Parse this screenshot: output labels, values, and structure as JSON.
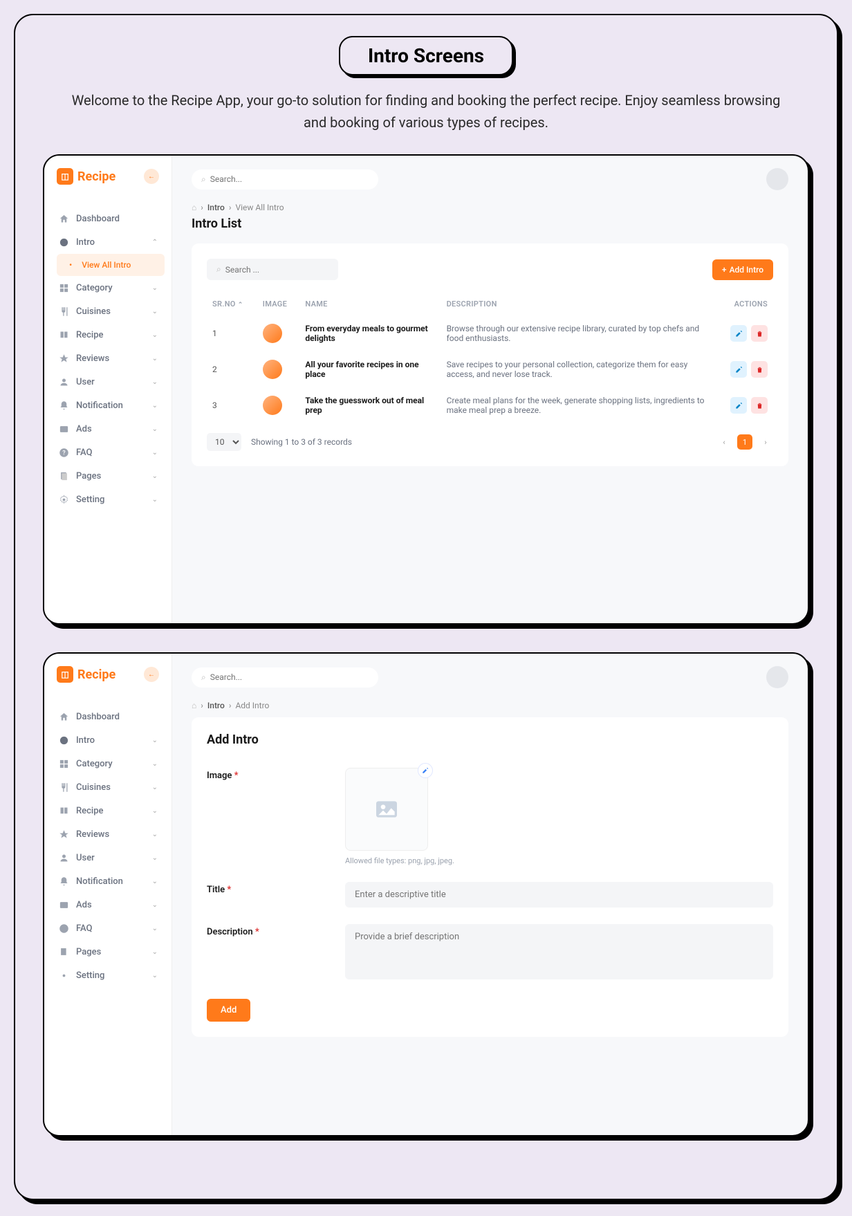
{
  "hero": {
    "title": "Intro Screens",
    "subtitle": "Welcome to the Recipe App, your go-to solution for finding and booking the perfect recipe. Enjoy seamless browsing and booking of various types of recipes."
  },
  "app_name": "Recipe",
  "search_placeholder": "Search...",
  "sidebar": {
    "items": [
      {
        "label": "Dashboard",
        "icon": "home"
      },
      {
        "label": "Intro",
        "icon": "dashboard",
        "expanded": true
      },
      {
        "label": "View All Intro",
        "sub": true,
        "active": true
      },
      {
        "label": "Category",
        "icon": "grid"
      },
      {
        "label": "Cuisines",
        "icon": "utensils"
      },
      {
        "label": "Recipe",
        "icon": "book"
      },
      {
        "label": "Reviews",
        "icon": "star"
      },
      {
        "label": "User",
        "icon": "user"
      },
      {
        "label": "Notification",
        "icon": "bell"
      },
      {
        "label": "Ads",
        "icon": "ad"
      },
      {
        "label": "FAQ",
        "icon": "help"
      },
      {
        "label": "Pages",
        "icon": "pages"
      },
      {
        "label": "Setting",
        "icon": "gear"
      }
    ]
  },
  "screen1": {
    "breadcrumb": {
      "a": "Intro",
      "b": "View All Intro"
    },
    "title": "Intro List",
    "search_placeholder": "Search ...",
    "add_button": "Add Intro",
    "columns": {
      "sr": "SR.NO",
      "image": "IMAGE",
      "name": "NAME",
      "desc": "DESCRIPTION",
      "actions": "ACTIONS"
    },
    "rows": [
      {
        "sr": "1",
        "name": "From everyday meals to gourmet delights",
        "desc": "Browse through our extensive recipe library, curated by top chefs and food enthusiasts."
      },
      {
        "sr": "2",
        "name": "All your favorite recipes in one place",
        "desc": "Save recipes to your personal collection, categorize them for easy access, and never lose track."
      },
      {
        "sr": "3",
        "name": "Take the guesswork out of meal prep",
        "desc": "Create meal plans for the week, generate shopping lists, ingredients to make meal prep a breeze."
      }
    ],
    "perpage": "10",
    "showing": "Showing 1 to 3 of 3 records",
    "page": "1"
  },
  "screen2": {
    "breadcrumb": {
      "a": "Intro",
      "b": "Add Intro"
    },
    "title": "Add Intro",
    "labels": {
      "image": "Image",
      "title": "Title",
      "desc": "Description"
    },
    "hint": "Allowed file types: png, jpg, jpeg.",
    "title_placeholder": "Enter a descriptive title",
    "desc_placeholder": "Provide a brief description",
    "submit": "Add"
  }
}
